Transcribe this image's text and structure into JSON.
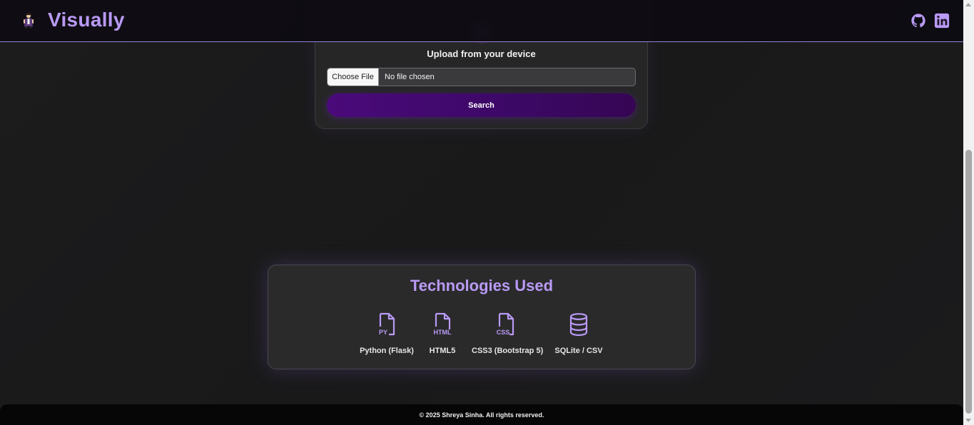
{
  "navbar": {
    "brand": "Visually",
    "icons": [
      "character-logo",
      "github-icon",
      "linkedin-icon"
    ]
  },
  "upload": {
    "title": "Upload from your device",
    "choose_file_label": "Choose File",
    "file_status": "No file chosen",
    "search_label": "Search"
  },
  "tech": {
    "title": "Technologies Used",
    "items": [
      {
        "icon": "python-file-icon",
        "icon_text": "PY",
        "label": "Python (Flask)"
      },
      {
        "icon": "html-file-icon",
        "icon_text": "HTML",
        "label": "HTML5"
      },
      {
        "icon": "css-file-icon",
        "icon_text": "CSS",
        "label": "CSS3 (Bootstrap 5)"
      },
      {
        "icon": "database-icon",
        "icon_text": "",
        "label": "SQLite / CSV"
      }
    ]
  },
  "footer": {
    "text": "© 2025 Shreya Sinha. All rights reserved."
  },
  "colors": {
    "accent": "#b99af5",
    "button": "#4a0a7a",
    "background": "#1a1a1b"
  }
}
